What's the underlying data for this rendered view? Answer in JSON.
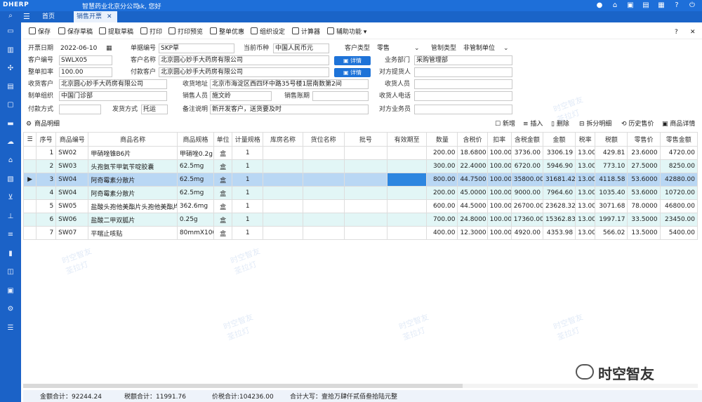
{
  "topbar": {
    "logo": "DHERP",
    "company": "智慧药业北京分公司",
    "user": "sk, 您好"
  },
  "tabs": {
    "home": "首页",
    "sales": "销售开票",
    "close": "✕"
  },
  "toolbar": {
    "save": "保存",
    "save_draft": "保存草稿",
    "fetch_draft": "提取草稿",
    "print": "打印",
    "print_preview": "打印预览",
    "discount": "整单优惠",
    "org_settings": "组织设定",
    "calculator": "计算器",
    "aux": "辅助功能"
  },
  "form": {
    "invoice_date_label": "开票日期",
    "invoice_date": "2022-06-10",
    "doc_no_label": "单据编号",
    "doc_no": "SKP草",
    "currency_label": "当前币种",
    "currency": "中国人民币元",
    "customer_type_label": "客户类型",
    "customer_type": "零售",
    "control_type_label": "管制类型",
    "control_type": "非管制单位",
    "customer_code_label": "客户编号",
    "customer_code": "SWLX05",
    "customer_name_label": "客户名称",
    "customer_name": "北京圆心妙手大药房有限公司",
    "detail_btn": "详情",
    "department_label": "业务部门",
    "department": "采购管理部",
    "discount_rate_label": "整单扣率",
    "discount_rate": "100.00",
    "pay_customer_label": "付款客户",
    "pay_customer": "北京圆心妙手大药房有限公司",
    "supplier_person_label": "对方提货人",
    "supplier_person": "",
    "receive_customer_label": "收货客户",
    "receive_customer": "北京圆心妙手大药房有限公司",
    "receive_address_label": "收货地址",
    "receive_address": "北京市海淀区西四环中路35号楼1层南数第2间",
    "receiver_label": "收货人员",
    "receiver": "",
    "org_label": "制单组织",
    "org": "中国门诊部",
    "salesperson_label": "销售人员",
    "salesperson": "施文岭",
    "sales_account_label": "销售账期",
    "sales_account": "",
    "receiver_phone_label": "收货人电话",
    "receiver_phone": "",
    "pay_method_label": "付款方式",
    "pay_method": "",
    "ship_method_label": "发货方式",
    "ship_method": "托运",
    "remark_label": "备注说明",
    "remark": "新开发客户，送货要及时",
    "counter_sales_label": "对方业务员",
    "counter_sales": ""
  },
  "section": {
    "title": "商品明细",
    "new": "新增",
    "insert": "插入",
    "delete": "删除",
    "split": "拆分明细",
    "history": "历史售价",
    "detail": "商品详情"
  },
  "grid": {
    "headers": [
      "序号",
      "商品编号",
      "商品名称",
      "商品规格",
      "单位",
      "计量规格",
      "库房名称",
      "货位名称",
      "批号",
      "有效期至",
      "数量",
      "含税价",
      "扣率",
      "含税金额",
      "金额",
      "税率",
      "税额",
      "零售价",
      "零售金额"
    ],
    "rows": [
      [
        "1",
        "SW02",
        "甲硝唑锥B6片",
        "甲硝唑0.2g",
        "盒",
        "1",
        "",
        "",
        "",
        "",
        "200.00",
        "18.6800",
        "100.00",
        "3736.00",
        "3306.19",
        "13.00",
        "429.81",
        "23.6000",
        "4720.00"
      ],
      [
        "2",
        "SW03",
        "头孢氨苄甲氧苄啶胶囊",
        "62.5mg",
        "盒",
        "1",
        "",
        "",
        "",
        "",
        "300.00",
        "22.4000",
        "100.00",
        "6720.00",
        "5946.90",
        "13.00",
        "773.10",
        "27.5000",
        "8250.00"
      ],
      [
        "3",
        "SW04",
        "阿奇霉素分散片",
        "62.5mg",
        "盒",
        "1",
        "",
        "",
        "",
        "",
        "800.00",
        "44.7500",
        "100.00",
        "35800.00",
        "31681.42",
        "13.00",
        "4118.58",
        "53.6000",
        "42880.00"
      ],
      [
        "4",
        "SW04",
        "阿奇霉素分散片",
        "62.5mg",
        "盒",
        "1",
        "",
        "",
        "",
        "",
        "200.00",
        "45.0000",
        "100.00",
        "9000.00",
        "7964.60",
        "13.00",
        "1035.40",
        "53.6000",
        "10720.00"
      ],
      [
        "5",
        "SW05",
        "盐酸头孢他美酯片头孢他美酯片",
        "362.6mg",
        "盒",
        "1",
        "",
        "",
        "",
        "",
        "600.00",
        "44.5000",
        "100.00",
        "26700.00",
        "23628.32",
        "13.00",
        "3071.68",
        "78.0000",
        "46800.00"
      ],
      [
        "6",
        "SW06",
        "盐酸二甲双胍片",
        "0.25g",
        "盒",
        "1",
        "",
        "",
        "",
        "",
        "700.00",
        "24.8000",
        "100.00",
        "17360.00",
        "15362.83",
        "13.00",
        "1997.17",
        "33.5000",
        "23450.00"
      ],
      [
        "7",
        "SW07",
        "平喘止咳贴",
        "80mmX100",
        "盒",
        "1",
        "",
        "",
        "",
        "",
        "400.00",
        "12.3000",
        "100.00",
        "4920.00",
        "4353.98",
        "13.00",
        "566.02",
        "13.5000",
        "5400.00"
      ]
    ]
  },
  "footer": {
    "amount_total": "金额合计：92244.24",
    "tax_total": "税额合计：11991.76",
    "price_tax_total": "价税合计:104236.00",
    "upper_total": "合计大写：壹拾万肆仟贰佰叁拾陆元整"
  },
  "watermark": {
    "line1": "时空智友",
    "line2": "荃拉灯"
  },
  "brand": {
    "wechat_name": "时空智友"
  }
}
